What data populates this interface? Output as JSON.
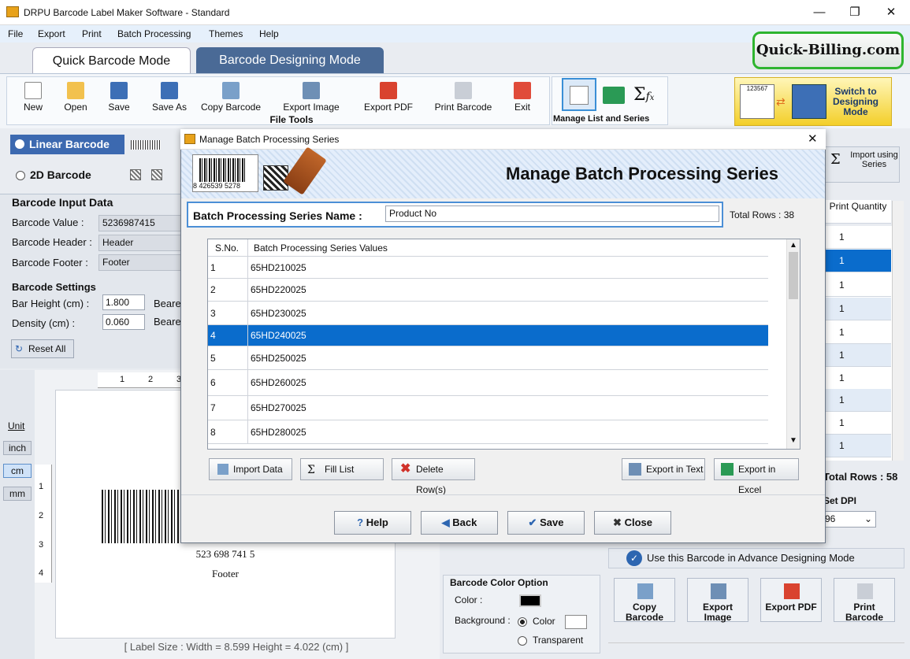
{
  "window": {
    "title": "DRPU Barcode Label Maker Software - Standard"
  },
  "menu": [
    "File",
    "Export",
    "Print",
    "Batch Processing",
    "Themes",
    "Help"
  ],
  "tabs": {
    "quick": "Quick Barcode Mode",
    "designing": "Barcode Designing Mode"
  },
  "logo": "Quick-Billing.com",
  "toolbar": {
    "items": [
      "New",
      "Open",
      "Save",
      "Save As",
      "Copy Barcode",
      "Export Image",
      "Export PDF",
      "Print Barcode",
      "Exit"
    ],
    "group_label": "File Tools",
    "manage_label": "Manage List and Series",
    "switch_label": "Switch to Designing Mode",
    "switch_sample": "123567"
  },
  "barcode_type": {
    "linear": "Linear Barcode",
    "twod": "2D Barcode"
  },
  "input": {
    "section": "Barcode Input Data",
    "value_label": "Barcode Value :",
    "value": "5236987415",
    "header_label": "Barcode Header :",
    "header": "Header",
    "footer_label": "Barcode Footer :",
    "footer": "Footer"
  },
  "settings": {
    "section": "Barcode Settings",
    "bar_height_label": "Bar Height (cm) :",
    "bar_height": "1.800",
    "density_label": "Density (cm) :",
    "density": "0.060",
    "bearer_label": "Beare",
    "reset": "Reset All"
  },
  "units": {
    "title": "Unit",
    "inch": "inch",
    "cm": "cm",
    "mm": "mm"
  },
  "ruler": {
    "top": [
      "1",
      "2",
      "3"
    ],
    "left": [
      "1",
      "2",
      "3",
      "4"
    ]
  },
  "preview": {
    "barcode_text": "523 698 741 5",
    "footer": "Footer"
  },
  "status": "[ Label Size : Width = 8.599  Height = 4.022 (cm) ]",
  "import_series": "Import using Series",
  "right_table": {
    "header": "Print Quantity",
    "rows": [
      "1",
      "1",
      "1",
      "1",
      "1",
      "1",
      "1",
      "1",
      "1",
      "1"
    ],
    "total": "Total Rows : 58"
  },
  "dpi": {
    "label": "Set DPI",
    "value": "96"
  },
  "advance": "Use this Barcode in Advance Designing Mode",
  "action_buttons": [
    "Copy Barcode",
    "Export Image",
    "Export PDF",
    "Print Barcode"
  ],
  "color_option": {
    "title": "Barcode Color Option",
    "color_label": "Color :",
    "background_label": "Background :",
    "bg_color_option": "Color",
    "bg_transparent_option": "Transparent",
    "barcode_color": "#000000"
  },
  "dialog": {
    "title": "Manage Batch Processing Series",
    "heading": "Manage Batch Processing Series",
    "banner_number": "8 426539 5278",
    "series_name_label": "Batch Processing Series Name :",
    "series_name_value": "Product No",
    "total_rows": "Total Rows : 38",
    "columns": [
      "S.No.",
      "Batch Processing Series Values"
    ],
    "rows": [
      [
        "1",
        "65HD210025"
      ],
      [
        "2",
        "65HD220025"
      ],
      [
        "3",
        "65HD230025"
      ],
      [
        "4",
        "65HD240025"
      ],
      [
        "5",
        "65HD250025"
      ],
      [
        "6",
        "65HD260025"
      ],
      [
        "7",
        "65HD270025"
      ],
      [
        "8",
        "65HD280025"
      ]
    ],
    "selected_row": 3,
    "buttons": {
      "import": "Import Data",
      "fill": "Fill List",
      "delete": "Delete Row(s)",
      "export_text": "Export in Text",
      "export_excel": "Export in Excel",
      "help": "Help",
      "back": "Back",
      "save": "Save",
      "close": "Close"
    }
  }
}
